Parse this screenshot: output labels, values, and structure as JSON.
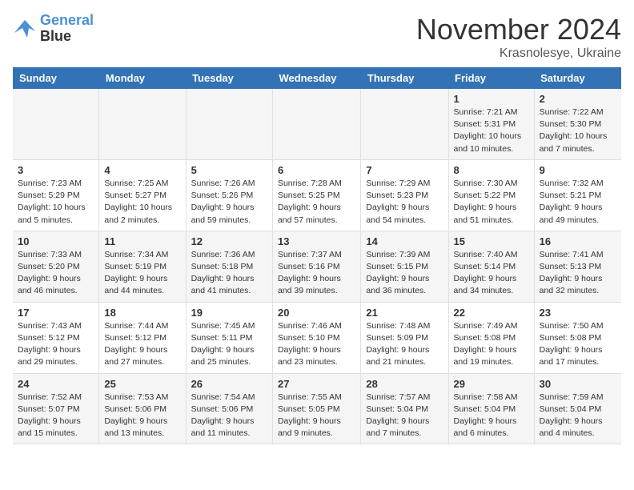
{
  "header": {
    "logo_line1": "General",
    "logo_line2": "Blue",
    "month": "November 2024",
    "location": "Krasnolesye, Ukraine"
  },
  "weekdays": [
    "Sunday",
    "Monday",
    "Tuesday",
    "Wednesday",
    "Thursday",
    "Friday",
    "Saturday"
  ],
  "weeks": [
    [
      {
        "day": "",
        "info": ""
      },
      {
        "day": "",
        "info": ""
      },
      {
        "day": "",
        "info": ""
      },
      {
        "day": "",
        "info": ""
      },
      {
        "day": "",
        "info": ""
      },
      {
        "day": "1",
        "info": "Sunrise: 7:21 AM\nSunset: 5:31 PM\nDaylight: 10 hours\nand 10 minutes."
      },
      {
        "day": "2",
        "info": "Sunrise: 7:22 AM\nSunset: 5:30 PM\nDaylight: 10 hours\nand 7 minutes."
      }
    ],
    [
      {
        "day": "3",
        "info": "Sunrise: 7:23 AM\nSunset: 5:29 PM\nDaylight: 10 hours\nand 5 minutes."
      },
      {
        "day": "4",
        "info": "Sunrise: 7:25 AM\nSunset: 5:27 PM\nDaylight: 10 hours\nand 2 minutes."
      },
      {
        "day": "5",
        "info": "Sunrise: 7:26 AM\nSunset: 5:26 PM\nDaylight: 9 hours\nand 59 minutes."
      },
      {
        "day": "6",
        "info": "Sunrise: 7:28 AM\nSunset: 5:25 PM\nDaylight: 9 hours\nand 57 minutes."
      },
      {
        "day": "7",
        "info": "Sunrise: 7:29 AM\nSunset: 5:23 PM\nDaylight: 9 hours\nand 54 minutes."
      },
      {
        "day": "8",
        "info": "Sunrise: 7:30 AM\nSunset: 5:22 PM\nDaylight: 9 hours\nand 51 minutes."
      },
      {
        "day": "9",
        "info": "Sunrise: 7:32 AM\nSunset: 5:21 PM\nDaylight: 9 hours\nand 49 minutes."
      }
    ],
    [
      {
        "day": "10",
        "info": "Sunrise: 7:33 AM\nSunset: 5:20 PM\nDaylight: 9 hours\nand 46 minutes."
      },
      {
        "day": "11",
        "info": "Sunrise: 7:34 AM\nSunset: 5:19 PM\nDaylight: 9 hours\nand 44 minutes."
      },
      {
        "day": "12",
        "info": "Sunrise: 7:36 AM\nSunset: 5:18 PM\nDaylight: 9 hours\nand 41 minutes."
      },
      {
        "day": "13",
        "info": "Sunrise: 7:37 AM\nSunset: 5:16 PM\nDaylight: 9 hours\nand 39 minutes."
      },
      {
        "day": "14",
        "info": "Sunrise: 7:39 AM\nSunset: 5:15 PM\nDaylight: 9 hours\nand 36 minutes."
      },
      {
        "day": "15",
        "info": "Sunrise: 7:40 AM\nSunset: 5:14 PM\nDaylight: 9 hours\nand 34 minutes."
      },
      {
        "day": "16",
        "info": "Sunrise: 7:41 AM\nSunset: 5:13 PM\nDaylight: 9 hours\nand 32 minutes."
      }
    ],
    [
      {
        "day": "17",
        "info": "Sunrise: 7:43 AM\nSunset: 5:12 PM\nDaylight: 9 hours\nand 29 minutes."
      },
      {
        "day": "18",
        "info": "Sunrise: 7:44 AM\nSunset: 5:12 PM\nDaylight: 9 hours\nand 27 minutes."
      },
      {
        "day": "19",
        "info": "Sunrise: 7:45 AM\nSunset: 5:11 PM\nDaylight: 9 hours\nand 25 minutes."
      },
      {
        "day": "20",
        "info": "Sunrise: 7:46 AM\nSunset: 5:10 PM\nDaylight: 9 hours\nand 23 minutes."
      },
      {
        "day": "21",
        "info": "Sunrise: 7:48 AM\nSunset: 5:09 PM\nDaylight: 9 hours\nand 21 minutes."
      },
      {
        "day": "22",
        "info": "Sunrise: 7:49 AM\nSunset: 5:08 PM\nDaylight: 9 hours\nand 19 minutes."
      },
      {
        "day": "23",
        "info": "Sunrise: 7:50 AM\nSunset: 5:08 PM\nDaylight: 9 hours\nand 17 minutes."
      }
    ],
    [
      {
        "day": "24",
        "info": "Sunrise: 7:52 AM\nSunset: 5:07 PM\nDaylight: 9 hours\nand 15 minutes."
      },
      {
        "day": "25",
        "info": "Sunrise: 7:53 AM\nSunset: 5:06 PM\nDaylight: 9 hours\nand 13 minutes."
      },
      {
        "day": "26",
        "info": "Sunrise: 7:54 AM\nSunset: 5:06 PM\nDaylight: 9 hours\nand 11 minutes."
      },
      {
        "day": "27",
        "info": "Sunrise: 7:55 AM\nSunset: 5:05 PM\nDaylight: 9 hours\nand 9 minutes."
      },
      {
        "day": "28",
        "info": "Sunrise: 7:57 AM\nSunset: 5:04 PM\nDaylight: 9 hours\nand 7 minutes."
      },
      {
        "day": "29",
        "info": "Sunrise: 7:58 AM\nSunset: 5:04 PM\nDaylight: 9 hours\nand 6 minutes."
      },
      {
        "day": "30",
        "info": "Sunrise: 7:59 AM\nSunset: 5:04 PM\nDaylight: 9 hours\nand 4 minutes."
      }
    ]
  ]
}
